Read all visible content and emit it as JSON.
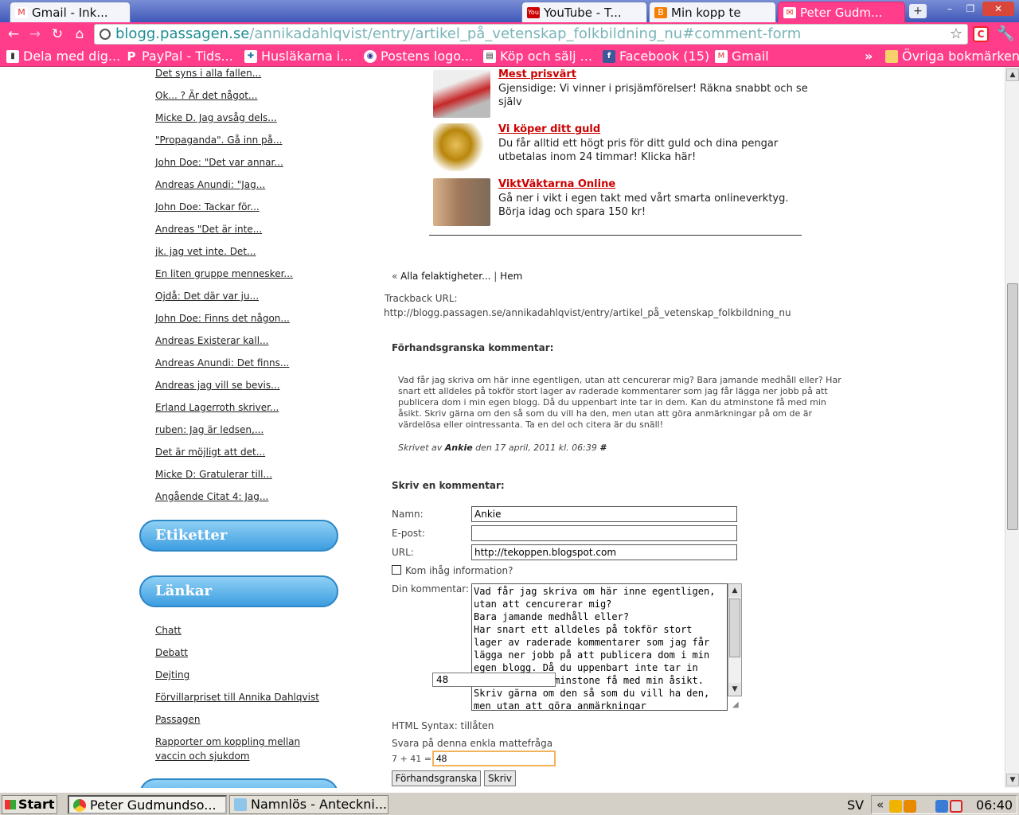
{
  "browser": {
    "tabs": [
      {
        "label": "Gmail - Ink...",
        "favicon": "gmail-icon"
      },
      {
        "label": "YouTube - T...",
        "favicon": "youtube-icon"
      },
      {
        "label": "Min kopp te",
        "favicon": "blogger-icon"
      },
      {
        "label": "Peter Gudm...",
        "favicon": "blog-icon"
      }
    ],
    "url_host": "blogg.passagen.se",
    "url_path": "/annikadahlqvist/entry/artikel_på_vetenskap_folkbildning_nu#comment-form",
    "bookmarks": [
      {
        "label": "Dela med dig...",
        "icon": "bookmark-icon"
      },
      {
        "label": "PayPal - Tids...",
        "icon": "paypal-icon"
      },
      {
        "label": "Husläkarna i...",
        "icon": "doctor-icon"
      },
      {
        "label": "Postens logo...",
        "icon": "post-icon"
      },
      {
        "label": "Köp och sälj ...",
        "icon": "page-icon"
      },
      {
        "label": "Facebook (15)",
        "icon": "facebook-icon"
      },
      {
        "label": "Gmail",
        "icon": "gmail-icon"
      }
    ],
    "bookmarks_more": "»",
    "other_bookmarks": "Övriga bokmärken"
  },
  "sidebar": {
    "recent_comments": [
      "Det syns i alla fallen...",
      "Ok... ? Är det något...",
      "Micke D. Jag avsåg dels...",
      "\"Propaganda\". Gå inn på...",
      "John Doe: \"Det var annar...",
      "Andreas Anundi: \"Jag...",
      "John Doe: Tackar för...",
      "Andreas \"Det är inte...",
      "jk. jag vet inte. Det...",
      "En liten gruppe mennesker...",
      "Ojdå: Det där var ju...",
      "John Doe: Finns det någon...",
      "Andreas Existerar kall...",
      "Andreas Anundi: Det finns...",
      "Andreas jag vill se bevis...",
      "Erland Lagerroth skriver...",
      "ruben: Jag är ledsen,...",
      "Det är möjligt att det...",
      "Micke D: Gratulerar till...",
      "Angående Citat 4: Jag..."
    ],
    "tags_header": "Etiketter",
    "links_header": "Länkar",
    "links": [
      "Chatt",
      "Debatt",
      "Dejting",
      "Förvillarpriset till Annika Dahlqvist",
      "Passagen",
      "Rapporter om koppling mellan",
      "vaccin och sjukdom"
    ]
  },
  "ads": [
    {
      "title": "Mest prisvärt",
      "text": "Gjensidige: Vi vinner i prisjämförelser! Räkna snabbt och se själv"
    },
    {
      "title": "Vi köper ditt guld",
      "text": "Du får alltid ett högt pris för ditt guld och dina pengar utbetalas inom 24 timmar! Klicka här!"
    },
    {
      "title": "ViktVäktarna Online",
      "text": "Gå ner i vikt i egen takt med vårt smarta onlineverktyg. Börja idag och spara 150 kr!"
    }
  ],
  "post_nav": {
    "prev_marker": "«",
    "prev_link": "Alla felaktigheter...",
    "separator": "|",
    "home_link": "Hem"
  },
  "trackback": {
    "label": "Trackback URL:",
    "url": "http://blogg.passagen.se/annikadahlqvist/entry/artikel_på_vetenskap_folkbildning_nu"
  },
  "preview": {
    "heading": "Förhandsgranska kommentar:",
    "text": "Vad får jag skriva om här inne egentligen, utan att cencurerar mig? Bara jamande medhåll eller? Har snart ett alldeles på tokför stort lager av raderade kommentarer som jag får lägga ner jobb på att publicera dom i min egen blogg. Då du uppenbart inte tar in dem. Kan du atminstone få med min åsikt. Skriv gärna om den så som du vill ha den, men utan att göra anmärkningar på om de är värdelösa eller ointressanta. Ta en del och citera är du snäll!",
    "written_by": "Skrivet av",
    "author": "Ankie",
    "date": "den 17 april, 2011 kl. 06:39",
    "permalink": "#"
  },
  "form": {
    "heading": "Skriv en kommentar:",
    "name_label": "Namn:",
    "name_value": "Ankie",
    "email_label": "E-post:",
    "email_value": "",
    "url_label": "URL:",
    "url_value": "http://tekoppen.blogspot.com",
    "remember_label": "Kom ihåg information?",
    "comment_label": "Din kommentar:",
    "comment_value": "Vad får jag skriva om här inne egentligen, utan att cencurerar mig?\nBara jamande medhåll eller?\nHar snart ett alldeles på tokför stort lager av raderade kommentarer som jag får lägga ner jobb på att publicera dom i min egen blogg. Då du uppenbart inte tar in dem. Kan du åtminstone få med min åsikt. Skriv gärna om den så som du vill ha den, men utan att göra anmärkningar",
    "autocomplete_value": "48",
    "html_syntax": "HTML Syntax: tillåten",
    "math_label": "Svara på denna enkla mattefråga",
    "math_question": "7 + 41 =",
    "math_value": "48",
    "preview_button": "Förhandsgranska",
    "submit_button": "Skriv"
  },
  "taskbar": {
    "start": "Start",
    "tasks": [
      "Peter Gudmundso...",
      "Namnlös - Anteckni..."
    ],
    "language": "SV",
    "tray_expand": "«",
    "clock": "06:40"
  }
}
